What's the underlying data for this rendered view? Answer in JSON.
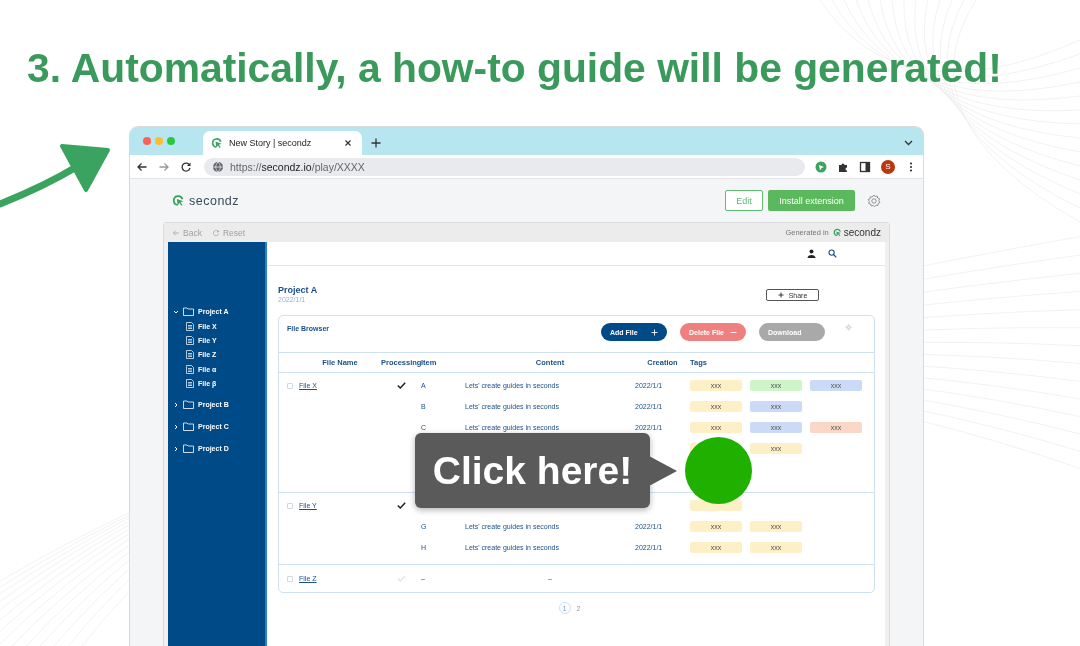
{
  "heading": "3. Automatically, a how-to guide will be generated!",
  "browser": {
    "tabs": [
      {
        "title": "New Story | secondz",
        "selected": true
      }
    ],
    "url": "https://**secondz.io**/play/XXXX",
    "profile_initial": "S"
  },
  "page": {
    "logo": "secondz",
    "edit": "Edit",
    "install": "Install extension"
  },
  "frame": {
    "back": "Back",
    "reset": "Reset",
    "generated_in": "Generated in",
    "brand": "secondz"
  },
  "sidebar": {
    "items": [
      {
        "label": "Project A",
        "expanded": true,
        "children": [
          {
            "label": "File X"
          },
          {
            "label": "File Y"
          },
          {
            "label": "File Z"
          },
          {
            "label": "File α"
          },
          {
            "label": "File β"
          }
        ]
      },
      {
        "label": "Project B",
        "expanded": false
      },
      {
        "label": "Project C",
        "expanded": false
      },
      {
        "label": "Project D",
        "expanded": false
      }
    ]
  },
  "project": {
    "title": "Project A",
    "date": "2022/1/1",
    "share": "Share"
  },
  "file_browser": {
    "title": "File Browser",
    "buttons": [
      {
        "label": "Add File",
        "kind": "add"
      },
      {
        "label": "Delete File",
        "kind": "delete"
      },
      {
        "label": "Download",
        "kind": "download"
      }
    ],
    "columns": [
      "File Name",
      "Processing",
      "Item",
      "Content",
      "Creation",
      "Tags"
    ],
    "files": [
      {
        "name": "File X",
        "checked": false,
        "processed": true,
        "rows": [
          {
            "item": "A",
            "content": "Lets' create guides in seconds",
            "creation": "2022/1/1",
            "tags": [
              {
                "text": "xxx",
                "color": "#fdefc6"
              },
              {
                "text": "xxx",
                "color": "#cdf5c8"
              },
              {
                "text": "xxx",
                "color": "#cbdaf7"
              }
            ]
          },
          {
            "item": "B",
            "content": "Lets' create guides in seconds",
            "creation": "2022/1/1",
            "tags": [
              {
                "text": "xxx",
                "color": "#fdefc6"
              },
              {
                "text": "xxx",
                "color": "#cbdaf7"
              }
            ]
          },
          {
            "item": "C",
            "content": "Lets' create guides in seconds",
            "creation": "2022/1/1",
            "tags": [
              {
                "text": "xxx",
                "color": "#fdefc6"
              },
              {
                "text": "xxx",
                "color": "#cbdaf7"
              },
              {
                "text": "xxx",
                "color": "#fbd7c8"
              }
            ]
          },
          {
            "tags": [
              {
                "color": "#fdefc6"
              },
              {
                "text": "xxx",
                "color": "#fdefc6"
              }
            ]
          }
        ]
      },
      {
        "name": "File Y",
        "checked": false,
        "processed": true,
        "rows": [
          {
            "tags": [
              {
                "color": "#fdefc6"
              }
            ]
          },
          {
            "item": "G",
            "content": "Lets' create guides in seconds",
            "creation": "2022/1/1",
            "tags": [
              {
                "text": "xxx",
                "color": "#fdefc6"
              },
              {
                "text": "xxx",
                "color": "#fdefc6"
              }
            ]
          },
          {
            "item": "H",
            "content": "Lets' create guides in seconds",
            "creation": "2022/1/1",
            "tags": [
              {
                "text": "xxx",
                "color": "#fdefc6"
              },
              {
                "text": "xxx",
                "color": "#fdefc6"
              }
            ]
          }
        ]
      },
      {
        "name": "File Z",
        "checked": false,
        "processed": false,
        "rows": [
          {
            "item": "–",
            "content": "–"
          }
        ]
      }
    ]
  },
  "pagination": [
    {
      "label": "1",
      "selected": true
    },
    {
      "label": "2",
      "selected": false
    }
  ],
  "callout": {
    "text": "Click here!"
  }
}
